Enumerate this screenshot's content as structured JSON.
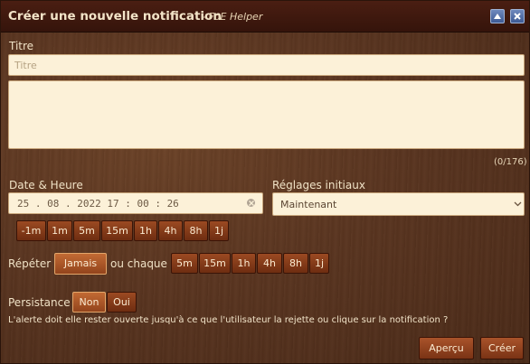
{
  "titlebar": {
    "title": "Créer une nouvelle notification",
    "subtitle": "- FoE Helper"
  },
  "form": {
    "title_label": "Titre",
    "title_placeholder": "Titre",
    "body_value": "",
    "char_counter": "(0/176)",
    "datetime_label": "Date & Heure",
    "datetime_value": "25 . 08 . 2022   17 : 00 : 26",
    "offset_buttons": [
      "-1m",
      "1m",
      "5m",
      "15m",
      "1h",
      "4h",
      "8h",
      "1j"
    ],
    "initial_label": "Réglages initiaux",
    "initial_selected": "Maintenant",
    "repeat_label": "Répéter",
    "repeat_never": "Jamais",
    "repeat_or_every": "ou chaque",
    "repeat_buttons": [
      "5m",
      "15m",
      "1h",
      "4h",
      "8h",
      "1j"
    ],
    "persistence_label": "Persistance",
    "persistence_no": "Non",
    "persistence_yes": "Oui",
    "persistence_description": "L'alerte doit elle rester ouverte jusqu'à ce que l'utilisateur la rejette ou clique sur la notification ?"
  },
  "footer": {
    "preview_label": "Aperçu",
    "create_label": "Créer"
  },
  "colors": {
    "button_active": "#c26a34",
    "button": "#8a3b18",
    "field_bg": "#fcf1d8",
    "titlebar_button": "#5a76ab"
  }
}
